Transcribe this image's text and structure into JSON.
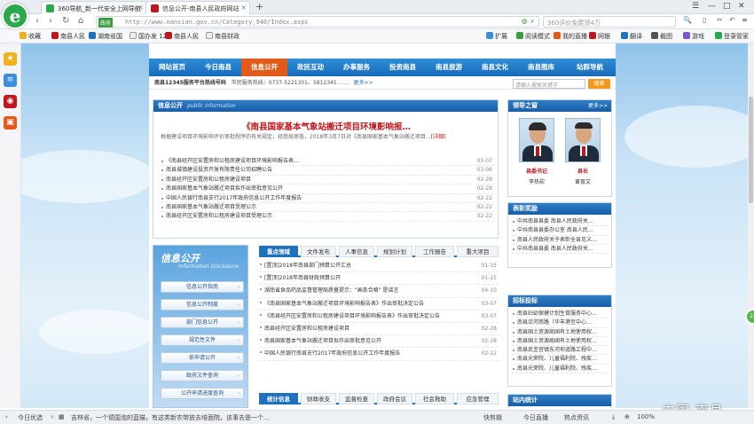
{
  "browser": {
    "tabs": [
      {
        "title": "360导航_新一代安全上网导航"
      },
      {
        "title": "信息公开-南县人民政府网站"
      }
    ],
    "url_badge": "政府",
    "url": "http://www.nanxian.gov.cn/Category_940/Index.aspx",
    "search_placeholder": "360评价免费领4万",
    "bookmarks": [
      "收藏",
      "南县人民",
      "湖南省国",
      "国办发 12",
      "南县人民",
      "南县财政"
    ],
    "bookmark_tools": [
      "扩展",
      "阅读模式",
      "我的直播",
      "网银",
      "翻译",
      "截图",
      "游戏",
      "登录管家"
    ]
  },
  "site": {
    "nav": [
      "网站首页",
      "今日南县",
      "信息公开",
      "政民互动",
      "办事服务",
      "投资南县",
      "南县旅游",
      "南县文化",
      "南县图库",
      "站群导航"
    ],
    "hotline": "南县12345服务平台热线号码",
    "hotline_detail": "市民服务热线：0737-5221301、5812345 ……",
    "hotline_more": "更多>>",
    "search_placeholder": "请输入搜索关键字",
    "search_button": "搜索",
    "info": {
      "title": "信息公开",
      "title_en": "public information",
      "headline": "《南县国家基本气象站搬迁项目环境影响报…",
      "summary": "根据建设项目环境影响评价审批程序的有关规定，经我局审查，2018年3月7日对《南县国家基本气象站搬迁项目…",
      "summary_link": "[详细]",
      "items": [
        {
          "text": "《南县经开区安置房和公租房建设项目环境影响报告表…",
          "date": "03-07"
        },
        {
          "text": "南县城镇建设投资开发有限责任公司招聘公告",
          "date": "03-06"
        },
        {
          "text": "南县经开区安置房和公租房建设项目",
          "date": "02-28"
        },
        {
          "text": "南县国家基本气象站搬迁项目拟作出审批意见公开",
          "date": "02-28"
        },
        {
          "text": "中国人民银行南县支行2017年政府信息公开工作年度报告",
          "date": "02-22"
        },
        {
          "text": "南县国家基本气象站搬迁项目受理公示",
          "date": "02-22"
        },
        {
          "text": "南县经开区安置房和公租房建设项目受理公示",
          "date": "02-22"
        }
      ]
    },
    "gov": {
      "title": "信息公开",
      "subtitle": "Information Disclosure",
      "buttons": [
        "信息公开指南",
        "信息公开制度",
        "部门信息公开",
        "规范性文件",
        "依申请公开",
        "政府文件查询",
        "公开申请进度查询"
      ]
    },
    "news_tabs": [
      "重点领域",
      "文件发布",
      "人事信息",
      "规划计划",
      "工作报告",
      "重大项目"
    ],
    "news": [
      {
        "text": "[置顶]2018年南县部门预算公开汇总",
        "date": "01-15"
      },
      {
        "text": "[置顶]2018年南县财政预算公开",
        "date": "01-15"
      },
      {
        "text": "湖南省食品药品监督管理局质量提示：\"画条合格\" 是谣言",
        "date": "04-10"
      },
      {
        "text": "《南县国家基本气象站搬迁项目环境影响报告表》作出审批决定公告",
        "date": "03-07"
      },
      {
        "text": "《南县经开区安置房和公租房建设项目环境影响报告表》作出审批决定公告",
        "date": "03-07"
      },
      {
        "text": "南县经开区安置房和公租房建设项目",
        "date": "02-28"
      },
      {
        "text": "南县国家基本气象站搬迁项目拟作出审批意见公开",
        "date": "02-28"
      },
      {
        "text": "中国人民银行南县支行2017年政府信息公开工作年度报告",
        "date": "02-22"
      }
    ],
    "stat_tabs": [
      "统计信息",
      "财政收支",
      "监督检查",
      "政府会议",
      "社会救助",
      "应急管理"
    ],
    "leaders": {
      "title": "领导之窗",
      "more": "更多>>",
      "people": [
        {
          "role": "县委书记",
          "name": "李热砍"
        },
        {
          "role": "县长",
          "name": "黄育文"
        }
      ]
    },
    "awards": {
      "title": "表彰奖励",
      "items": [
        "中共南县县委 南县人民政府关…",
        "中共南县县委办公室 南县人民…",
        "南县人民政府关于表彰全县见义…",
        "中共南县县委 南县人民政府关…"
      ]
    },
    "tenders": {
      "title": "招标投标",
      "items": [
        "南县妇幼保健计划生育服务中心…",
        "南县沿河南路（华丰港至中心…",
        "南县国土资源局国有土地使用权…",
        "南县国土资源局国有土地使用权…",
        "南县武圣宫镇东河坝道路工程中…",
        "南县光荣院、儿童福利院、残疾…",
        "南县光荣院、儿童福利院、残疾…"
      ]
    },
    "visits": {
      "title": "站内统计"
    }
  },
  "overlay_text": "中国·南县",
  "statusbar": {
    "left": "今日优选",
    "news": "吉林省，一个德国泡的蓝猫，有这类新农带放去培面院，该事去是一个…",
    "right": [
      "快剪辑",
      "今日直播",
      "热点资讯"
    ],
    "zoom": "100%"
  }
}
